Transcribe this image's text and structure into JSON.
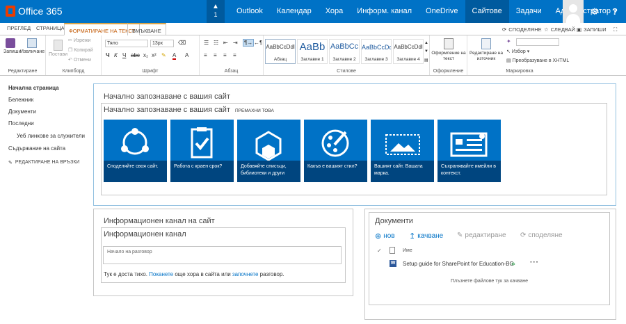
{
  "suitebar": {
    "brand": "Office 365",
    "notification_count": "1",
    "nav": [
      "Outlook",
      "Календар",
      "Хора",
      "Информ. канал",
      "OneDrive",
      "Сайтове",
      "Задачи",
      "Администратор"
    ],
    "active_nav": "Сайтове",
    "settings_icon": "gear-icon",
    "help_icon": "?"
  },
  "ribbon_tabs": {
    "tabs": [
      "ПРЕГЛЕД",
      "СТРАНИЦА",
      "ФОРМАТИРАНЕ НА ТЕКСТ",
      "ВМЪКВАНЕ"
    ],
    "active": "ФОРМАТИРАНЕ НА ТЕКСТ",
    "actions": [
      "СПОДЕЛЯНЕ",
      "СЛЕДВАЙ",
      "ЗАПИШИ"
    ]
  },
  "ribbon": {
    "edit_group": {
      "label": "Редактиране",
      "save": "Запиши",
      "check_out": "Извличане"
    },
    "clipboard": {
      "label": "Клипборд",
      "paste": "Постави",
      "cut": "Изрежи",
      "copy": "Копирай",
      "undo": "Отмени"
    },
    "font": {
      "label": "Шрифт",
      "font_name": "Тяло",
      "font_size": "13px"
    },
    "paragraph": {
      "label": "Абзац"
    },
    "styles": {
      "label": "Стилове",
      "items": [
        {
          "sample": "AaBbCcDdl",
          "caption": "Абзац"
        },
        {
          "sample": "AaBb",
          "caption": "Заглавие 1"
        },
        {
          "sample": "AaBbCc",
          "caption": "Заглавие 2"
        },
        {
          "sample": "AaBbCcDd",
          "caption": "Заглавие 3"
        },
        {
          "sample": "AaBbCcDdl",
          "caption": "Заглавие 4"
        }
      ]
    },
    "layout": {
      "label": "Оформление",
      "text_layout": "Оформление на текст"
    },
    "markup": {
      "label": "Маркировка",
      "edit_source": "Редактиране на източник",
      "select": "Избор",
      "convert": "Преобразуване в XHTML"
    }
  },
  "leftnav": {
    "items": [
      "Начална страница",
      "Бележник",
      "Документи",
      "Последни",
      "Уеб линкове за служители",
      "Съдържание на сайта"
    ],
    "edit_links": "РЕДАКТИРАНЕ НА ВРЪЗКИ"
  },
  "get_started": {
    "title": "Начално запознаване с вашия сайт",
    "subtitle": "Начално запознаване с вашия сайт",
    "remove": "ПРЕМАХНИ ТОВА",
    "tiles": [
      {
        "label": "Споделяйте своя сайт.",
        "icon": "share-icon"
      },
      {
        "label": "Работа с краен срок?",
        "icon": "clipboard-check-icon"
      },
      {
        "label": "Добавяйте списъци, библиотеки и други",
        "icon": "apps-icon"
      },
      {
        "label": "Какъв е вашият стил?",
        "icon": "palette-icon"
      },
      {
        "label": "Вашият сайт. Вашата марка.",
        "icon": "image-icon"
      },
      {
        "label": "Съхранявайте имейли в контекст.",
        "icon": "mail-icon"
      }
    ]
  },
  "site_feed": {
    "title": "Информационен канал на сайт",
    "subtitle": "Информационен канал",
    "placeholder": "Начало на разговор",
    "quiet_prefix": "Тук е доста тихо.",
    "invite_link": "Поканете",
    "middle_text": "още хора в сайта или",
    "start_link": "започнете",
    "suffix": "разговор."
  },
  "documents": {
    "title": "Документи",
    "new": "нов",
    "upload": "качване",
    "edit": "редактиране",
    "share": "споделяне",
    "column_name": "Име",
    "file": "Setup guide for SharePoint for Education-BG",
    "drop_hint": "Плъзнете файлове тук за качване"
  }
}
